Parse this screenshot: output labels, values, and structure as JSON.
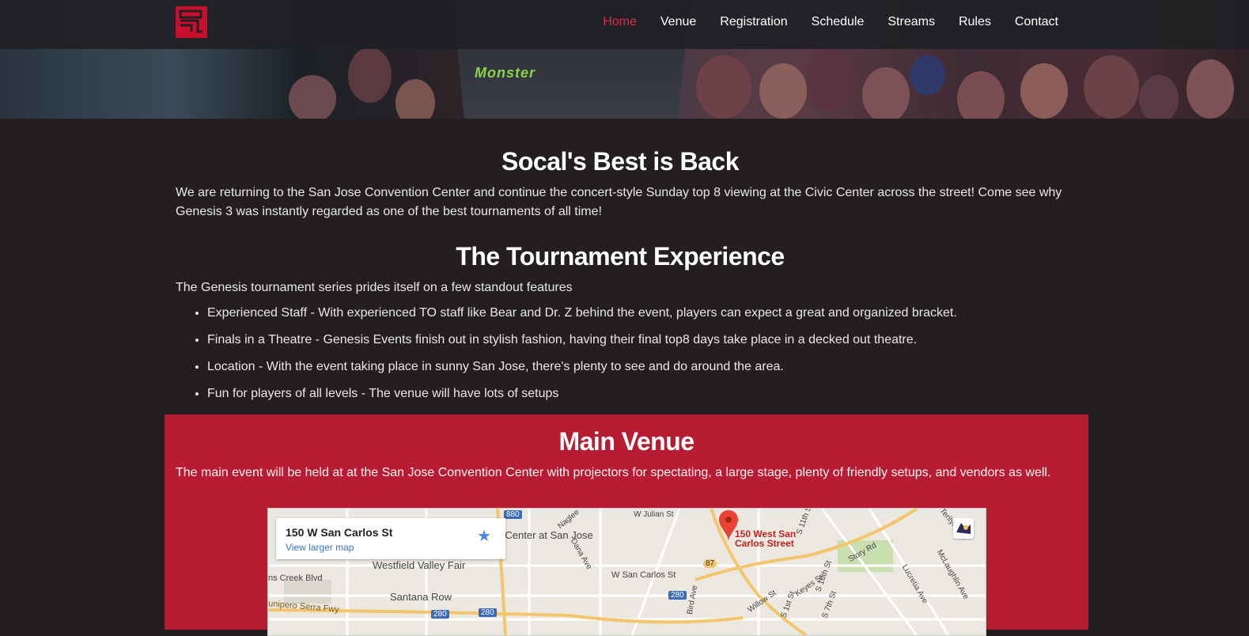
{
  "nav": {
    "brand_logo": "genesis-logo",
    "items": [
      {
        "label": "Home",
        "active": true
      },
      {
        "label": "Venue",
        "active": false
      },
      {
        "label": "Registration",
        "active": false
      },
      {
        "label": "Schedule",
        "active": false
      },
      {
        "label": "Streams",
        "active": false
      },
      {
        "label": "Rules",
        "active": false
      },
      {
        "label": "Contact",
        "active": false
      }
    ]
  },
  "hero": {
    "shirt_text": "Monster"
  },
  "intro": {
    "title": "Socal's Best is Back",
    "text": "We are returning to the San Jose Convention Center and continue the concert-style Sunday top 8 viewing at the Civic Center across the street! Come see why Genesis 3 was instantly regarded as one of the best tournaments of all time!"
  },
  "experience": {
    "title": "The Tournament Experience",
    "intro": "The Genesis tournament series prides itself on a few standout features",
    "features": [
      "Experienced Staff - With experienced TO staff like Bear and Dr. Z behind the event, players can expect a great and organized bracket.",
      "Finals in a Theatre - Genesis Events finish out in stylish fashion, having their final top8 days take place in a decked out theatre.",
      "Location - With the event taking place in sunny San Jose, there's plenty to see and do around the area.",
      "Fun for players of all levels - The venue will have lots of setups"
    ]
  },
  "venue": {
    "title": "Main Venue",
    "text": "The main event will be held at at the San Jose Convention Center with projectors for spectating, a large stage, plenty of friendly setups, and vendors as well."
  },
  "map": {
    "card_address": "150 W San Carlos St",
    "card_link": "View larger map",
    "pin_label_line1": "150 West San",
    "pin_label_line2": "Carlos Street",
    "labels": {
      "sap": "SAP Center at San Jose",
      "westfield": "Westfield Valley Fair",
      "santana": "Santana Row",
      "creek": "ns Creek Blvd",
      "junipero": "unipero Serra Fwy",
      "sancarlos": "W San Carlos St",
      "julian": "W Julian St",
      "naglee": "Naglee",
      "dana": "Dana Ave",
      "bird": "Bird Ave",
      "willow": "Willow St",
      "keyes": "Keyes St",
      "story": "Story Rd",
      "lucretia": "Lucretia Ave",
      "mclaughlin": "McLaughlin Ave",
      "tenth": "S 10th St",
      "seventh": "S 7th St",
      "eleventh": "S 11th St",
      "first": "S 1st St",
      "terilyn": "Terilyn Ave",
      "hw880": "880",
      "hw280a": "280",
      "hw280b": "280",
      "hw280c": "280",
      "hw87": "87"
    }
  }
}
